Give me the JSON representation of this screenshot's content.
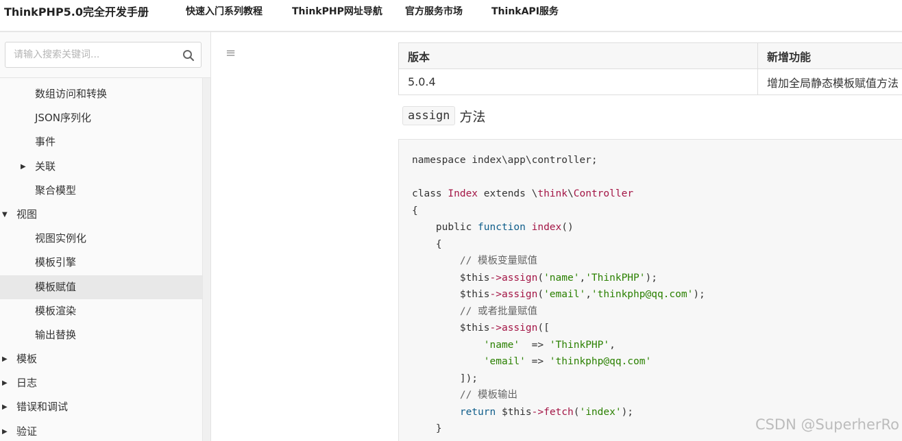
{
  "topnav": {
    "brand": "ThinkPHP5.0完全开发手册",
    "links": [
      "快速入门系列教程",
      "ThinkPHP网址导航",
      "官方服务市场",
      "ThinkAPI服务"
    ]
  },
  "sidebar": {
    "search_placeholder": "请输入搜索关键词...",
    "items": [
      {
        "label": "数组访问和转换",
        "level": 2
      },
      {
        "label": "JSON序列化",
        "level": 2
      },
      {
        "label": "事件",
        "level": 2
      },
      {
        "label": "关联",
        "level": 2,
        "caret": "right"
      },
      {
        "label": "聚合模型",
        "level": 2
      },
      {
        "label": "视图",
        "level": 1,
        "caret": "down"
      },
      {
        "label": "视图实例化",
        "level": 2
      },
      {
        "label": "模板引擎",
        "level": 2
      },
      {
        "label": "模板赋值",
        "level": 2,
        "active": true
      },
      {
        "label": "模板渲染",
        "level": 2
      },
      {
        "label": "输出替换",
        "level": 2
      },
      {
        "label": "模板",
        "level": 1,
        "caret": "right"
      },
      {
        "label": "日志",
        "level": 1,
        "caret": "right"
      },
      {
        "label": "错误和调试",
        "level": 1,
        "caret": "right"
      },
      {
        "label": "验证",
        "level": 1,
        "caret": "right"
      }
    ]
  },
  "main": {
    "menu_icon": "hamburger-icon",
    "version_table": {
      "headers": [
        "版本",
        "新增功能"
      ],
      "rows": [
        [
          "5.0.4",
          "增加全局静态模板赋值方法"
        ]
      ]
    },
    "method_heading": {
      "code": "assign",
      "text": "方法"
    },
    "code": [
      "namespace index\\app\\controller;",
      "",
      "class Index extends \\think\\Controller",
      "{",
      "    public function index()",
      "    {",
      "        // 模板变量赋值",
      "        $this->assign('name','ThinkPHP');",
      "        $this->assign('email','thinkphp@qq.com');",
      "        // 或者批量赋值",
      "        $this->assign([",
      "            'name'  => 'ThinkPHP',",
      "            'email' => 'thinkphp@qq.com'",
      "        ]);",
      "        // 模板输出",
      "        return $this->fetch('index');",
      "    }"
    ]
  },
  "watermark": "CSDN @SuperherRo",
  "colors": {
    "keyword": "#0000aa",
    "string": "#2a8000",
    "class": "#a31545",
    "active_bg": "#e8e8e8"
  }
}
